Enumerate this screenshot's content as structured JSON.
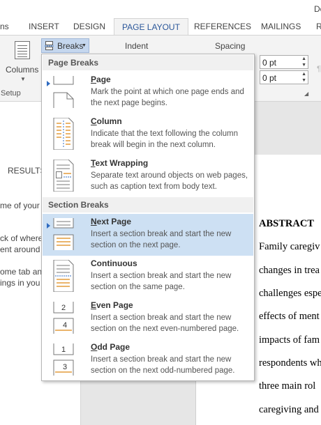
{
  "window": {
    "title_fragment": "Do"
  },
  "tabs": [
    {
      "label": "ns"
    },
    {
      "label": "INSERT"
    },
    {
      "label": "DESIGN"
    },
    {
      "label": "PAGE LAYOUT",
      "active": true
    },
    {
      "label": "REFERENCES"
    },
    {
      "label": "MAILINGS"
    },
    {
      "label": "R"
    }
  ],
  "ribbon": {
    "columns_label": "Columns",
    "setup_label": "Setup",
    "breaks_label": "Breaks",
    "indent_label": "Indent",
    "spacing_label": "Spacing",
    "spacing_before": "0 pt",
    "spacing_after": "0 pt"
  },
  "breaks_menu": {
    "page_breaks_header": "Page Breaks",
    "section_breaks_header": "Section Breaks",
    "items": [
      {
        "accel": "P",
        "rest": "age",
        "desc": "Mark the point at which one page ends and the next page begins.",
        "icon": "page-break-icon"
      },
      {
        "accel": "C",
        "rest": "olumn",
        "desc": "Indicate that the text following the column break will begin in the next column.",
        "icon": "column-break-icon"
      },
      {
        "accel": "T",
        "rest": "ext Wrapping",
        "desc": "Separate text around objects on web pages, such as caption text from body text.",
        "icon": "text-wrapping-icon"
      },
      {
        "accel": "N",
        "rest": "ext Page",
        "desc": "Insert a section break and start the new section on the next page.",
        "icon": "next-page-icon",
        "highlighted": true
      },
      {
        "accel": "",
        "rest": "Continuous",
        "desc": "Insert a section break and start the new section on the same page.",
        "icon": "continuous-icon"
      },
      {
        "accel": "E",
        "rest": "ven Page",
        "desc": "Insert a section break and start the new section on the next even-numbered page.",
        "icon": "even-page-icon",
        "num_top": "2",
        "num_bottom": "4"
      },
      {
        "accel": "O",
        "rest": "dd Page",
        "desc": "Insert a section break and start the new section on the next odd-numbered page.",
        "icon": "odd-page-icon",
        "num_top": "1",
        "num_bottom": "3"
      }
    ]
  },
  "nav_pane": {
    "results_label": "RESULTS",
    "lines": [
      "me of your",
      "ck of where",
      "ent around",
      "ome tab and",
      "ings in you"
    ]
  },
  "document": {
    "heading": "ABSTRACT",
    "lines": [
      "Family caregiv",
      "changes in trea",
      "challenges espe",
      "effects of ment",
      "impacts of fam",
      "respondents wh",
      "three main rol",
      "caregiving and"
    ]
  },
  "colors": {
    "accent": "#2b579a",
    "highlight": "#cde0f3",
    "breaks_button": "#c5d7ee"
  }
}
